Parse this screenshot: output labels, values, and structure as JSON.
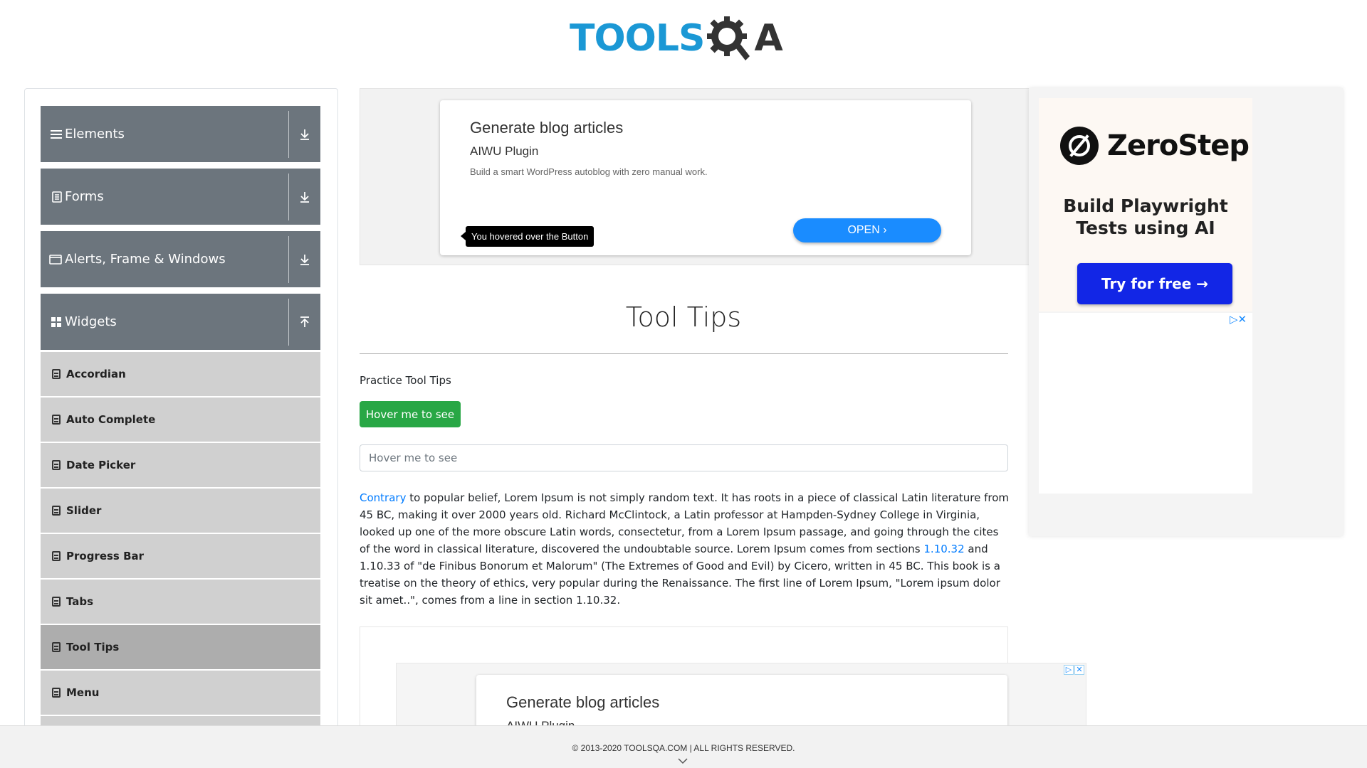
{
  "header": {
    "logo_tools": "TOOLS",
    "logo_qa": "A"
  },
  "sidebar": {
    "groups": [
      {
        "label": "Elements",
        "icon": "menu-icon",
        "expanded": false
      },
      {
        "label": "Forms",
        "icon": "document-icon",
        "expanded": false
      },
      {
        "label": "Alerts, Frame & Windows",
        "icon": "window-icon",
        "expanded": false
      },
      {
        "label": "Widgets",
        "icon": "grid-icon",
        "expanded": true
      }
    ],
    "items": [
      {
        "label": "Accordian"
      },
      {
        "label": "Auto Complete"
      },
      {
        "label": "Date Picker"
      },
      {
        "label": "Slider"
      },
      {
        "label": "Progress Bar"
      },
      {
        "label": "Tabs"
      },
      {
        "label": "Tool Tips",
        "active": true
      },
      {
        "label": "Menu"
      }
    ]
  },
  "ad_top": {
    "title": "Generate blog articles",
    "subtitle": "AIWU Plugin",
    "description": "Build a smart WordPress autoblog with zero manual work.",
    "open_label": "OPEN ›",
    "tooltip": "You hovered over the Button"
  },
  "main": {
    "title": "Tool Tips",
    "practice_label": "Practice Tool Tips",
    "hover_button": "Hover me to see",
    "hover_input_placeholder": "Hover me to see",
    "lorem": {
      "link1": "Contrary",
      "part1": " to popular belief, Lorem Ipsum is not simply random text. It has roots in a piece of classical Latin literature from 45 BC, making it over 2000 years old. Richard McClintock, a Latin professor at Hampden-Sydney College in Virginia, looked up one of the more obscure Latin words, consectetur, from a Lorem Ipsum passage, and going through the cites of the word in classical literature, discovered the undoubtable source. Lorem Ipsum comes from sections ",
      "link2": "1.10.32",
      "part2": " and 1.10.33 of \"de Finibus Bonorum et Malorum\" (The Extremes of Good and Evil) by Cicero, written in 45 BC. This book is a treatise on the theory of ethics, very popular during the Renaissance. The first line of Lorem Ipsum, \"Lorem ipsum dolor sit amet..\", comes from a line in section 1.10.32."
    }
  },
  "ad_bottom": {
    "title": "Generate blog articles",
    "subtitle": "AIWU Plugin"
  },
  "ad_right": {
    "brand": "ZeroStep",
    "headline_line1": "Build Playwright",
    "headline_line2": "Tests using AI",
    "cta": "Try for free →"
  },
  "footer": {
    "copyright": "© 2013-2020 TOOLSQA.COM | ALL RIGHTS RESERVED."
  },
  "colors": {
    "brand_blue": "#1b98d5",
    "menu_header": "#6c757d",
    "button_green": "#28a745",
    "link_blue": "#007bff",
    "cta_blue": "#1226e6"
  }
}
